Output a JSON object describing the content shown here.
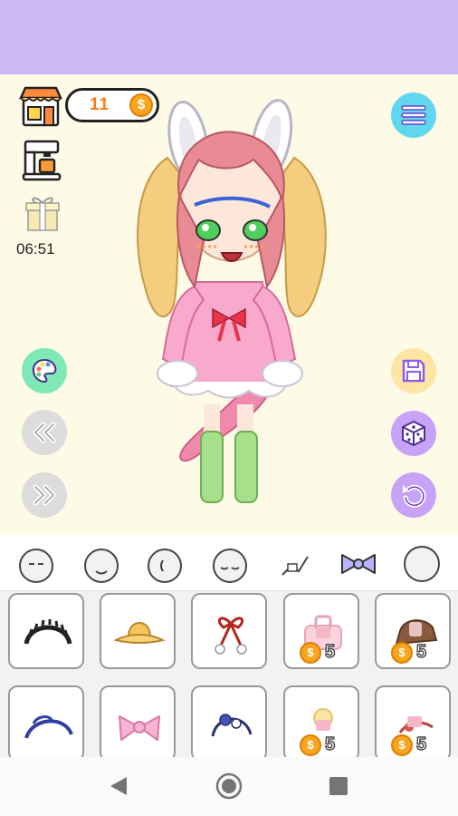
{
  "hud": {
    "coins": "11",
    "coin_symbol": "$",
    "timer": "06:51"
  },
  "icons": {
    "shop": "shop-icon",
    "coffee": "coffee-machine-icon",
    "gift": "gift-icon",
    "menu": "menu-icon",
    "palette": "palette-icon",
    "prev": "double-chevron-left-icon",
    "next": "double-chevron-right-icon",
    "save": "save-icon",
    "random": "dice-icon",
    "undo": "undo-icon"
  },
  "categories": [
    "face-shape-icon",
    "mouth-icon",
    "ear-icon",
    "eyes-closed-icon",
    "face-accessory-icon",
    "bow-icon",
    "head-icon"
  ],
  "tiles": [
    {
      "item": "black-headband",
      "price": null
    },
    {
      "item": "yellow-sun-hat",
      "price": null
    },
    {
      "item": "red-ribbon-pom-poms",
      "price": null
    },
    {
      "item": "pink-bag-locked",
      "price": "5"
    },
    {
      "item": "brown-hat-locked",
      "price": "5"
    },
    {
      "item": "blue-feather-headband",
      "price": null
    },
    {
      "item": "pink-bow",
      "price": null
    },
    {
      "item": "blue-flower-crown",
      "price": null
    },
    {
      "item": "yellow-pin-locked",
      "price": "5"
    },
    {
      "item": "red-flower-locked",
      "price": "5"
    }
  ],
  "colors": {
    "top_bar": "#ccb9f5",
    "stage": "#fdfbe6",
    "coin_text": "#ff7a1a",
    "menu_button": "#5fd8ef",
    "palette_button": "#7ee8b6",
    "save_button": "#ffe5a3",
    "accent_purple": "#c7a3f7"
  }
}
